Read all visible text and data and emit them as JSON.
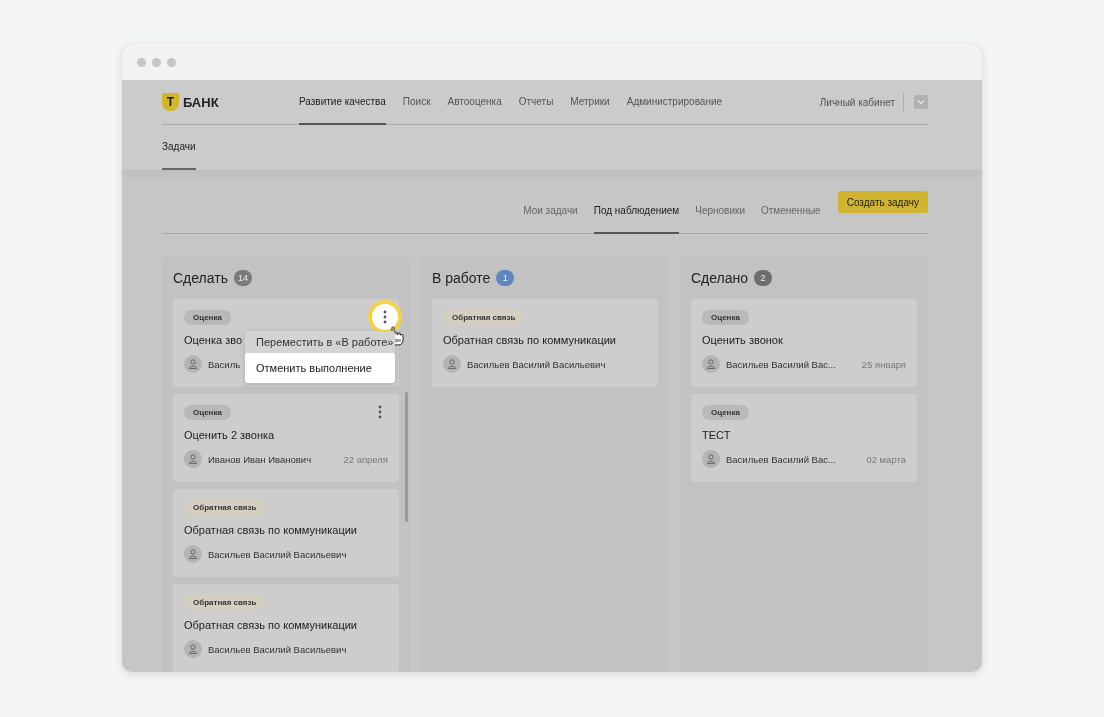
{
  "logo": {
    "mark": "Т",
    "name": "БАНК"
  },
  "nav": [
    {
      "label": "Развитие качества",
      "selected": true
    },
    {
      "label": "Поиск",
      "selected": false
    },
    {
      "label": "Автооценка",
      "selected": false
    },
    {
      "label": "Отчеты",
      "selected": false
    },
    {
      "label": "Метрики",
      "selected": false
    },
    {
      "label": "Администрирование",
      "selected": false
    }
  ],
  "account": {
    "label": "Личный кабинет"
  },
  "subnav": [
    {
      "label": "Задачи",
      "selected": true
    }
  ],
  "filters": [
    {
      "label": "Мои задачи",
      "selected": false
    },
    {
      "label": "Под наблюдением",
      "selected": true
    },
    {
      "label": "Черновики",
      "selected": false
    },
    {
      "label": "Отмененные",
      "selected": false
    }
  ],
  "create_button": "Создать задачу",
  "columns": [
    {
      "title": "Сделать",
      "count": "14",
      "color": "#7b7b7b",
      "scrollbar": true,
      "cards": [
        {
          "tag": {
            "label": "Оценка",
            "color": "#b9b9b9"
          },
          "title": "Оценка зво",
          "person": "Василь",
          "menu": true,
          "highlighted": true
        },
        {
          "tag": {
            "label": "Оценка",
            "color": "#b9b9b9"
          },
          "title": "Оценить 2 звонка",
          "person": "Иванов Иван Иванович",
          "date": "22 апреля",
          "menu": true,
          "highlighted": false
        },
        {
          "tag": {
            "label": "Обратная связь",
            "color": "#d4cfc0"
          },
          "title": "Обратная связь по коммуникации",
          "person": "Васильев Василий Васильевич",
          "menu": false,
          "highlighted": false
        },
        {
          "tag": {
            "label": "Обратная связь",
            "color": "#d4cfc0"
          },
          "title": "Обратная связь по коммуникации",
          "person": "Васильев Василий Васильевич",
          "menu": false,
          "highlighted": false
        }
      ]
    },
    {
      "title": "В работе",
      "count": "1",
      "color": "#5f87bd",
      "scrollbar": false,
      "cards": [
        {
          "tag": {
            "label": "Обратная связь",
            "color": "#d4cfc0"
          },
          "title": "Обратная связь по коммуникации",
          "person": "Васильев Василий Васильевич",
          "menu": false,
          "highlighted": false
        }
      ]
    },
    {
      "title": "Сделано",
      "count": "2",
      "color": "#6e6e6e",
      "scrollbar": false,
      "cards": [
        {
          "tag": {
            "label": "Оценка",
            "color": "#b9b9b9"
          },
          "title": "Оценить звонок",
          "person": "Васильев Василий Вас...",
          "date": "25 января",
          "menu": false,
          "highlighted": false
        },
        {
          "tag": {
            "label": "Оценка",
            "color": "#b9b9b9"
          },
          "title": "ТЕСТ",
          "person": "Васильев Василий Вас...",
          "date": "02 марта",
          "menu": false,
          "highlighted": false
        }
      ]
    }
  ],
  "context_menu": [
    {
      "label": "Переместить в «В работе»",
      "selected": false
    },
    {
      "label": "Отменить выполнение",
      "selected": true
    }
  ]
}
